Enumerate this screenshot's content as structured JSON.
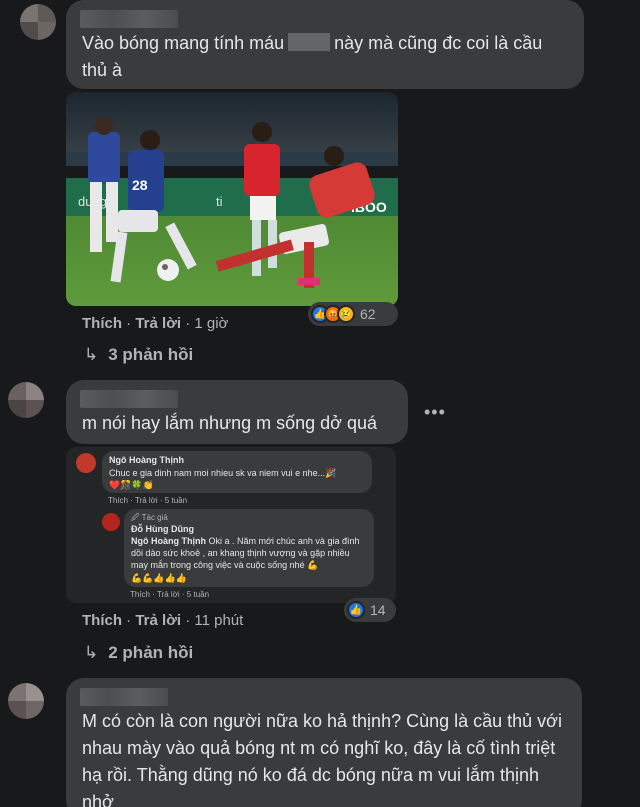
{
  "comments": [
    {
      "text_before": "Vào bóng mang tính máu",
      "text_after": "này mà cũng đc coi là cầu thủ à",
      "actions": {
        "like": "Thích",
        "reply": "Trả lời",
        "time": "1 giờ"
      },
      "reaction_count": "62",
      "replies": "3 phản hồi"
    },
    {
      "text": "m nói hay lắm nhưng m sống dở quá",
      "actions": {
        "like": "Thích",
        "reply": "Trả lời",
        "time": "11 phút"
      },
      "reaction_count": "14",
      "replies": "2 phản hồi",
      "more": "•••",
      "embedded": {
        "author1": "Ngô Hoàng Thịnh",
        "msg1": "Chuc e gia dinh nam moi nhieu sk va niem vui e nhe...🎉",
        "emojis1": "❤️🎊🍀👏",
        "meta1": "Thích · Trả lời · 5 tuần",
        "tag": "🖉 Tác giả",
        "author2": "Đỗ Hùng Dũng",
        "msg2_mention": "Ngô Hoàng Thịnh",
        "msg2": "Oki a . Năm mới chúc anh và gia đình dồi dào sức khoẻ , an khang thịnh vượng và gặp nhiều may mắn trong công việc và cuộc sống nhé 💪",
        "emojis2": "💪💪👍👍👍",
        "meta2": "Thích · Trả lời · 5 tuần"
      }
    },
    {
      "text": "M có còn là con người nữa ko hả thịnh? Cùng là cầu thủ với nhau mày vào quả bóng nt m có nghĩ ko, đây là cố tình triệt hạ rồi. Thằng dũng nó ko đá dc bóng nữa m vui lắm thịnh nhở"
    }
  ],
  "colors": {
    "bg": "#18191a",
    "bubble": "#3a3b3c",
    "text": "#e4e6eb",
    "meta": "#b0b3b8",
    "like": "#1877f2"
  }
}
